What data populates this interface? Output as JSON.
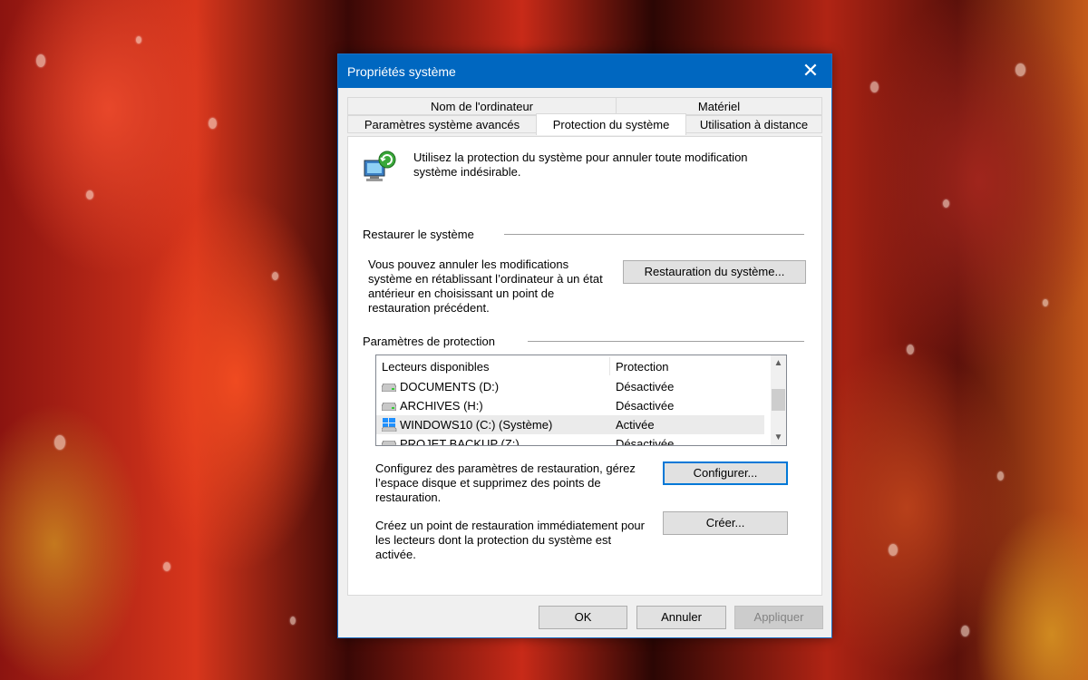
{
  "window": {
    "title": "Propriétés système",
    "close_glyph": "✕"
  },
  "tabs": {
    "row1": [
      "Nom de l'ordinateur",
      "Matériel"
    ],
    "row2": [
      "Paramètres système avancés",
      "Protection du système",
      "Utilisation à distance"
    ],
    "active": "Protection du système"
  },
  "intro": {
    "icon": "system-protection-icon",
    "text_line1": "Utilisez la protection du système pour annuler toute modification",
    "text_line2": "système indésirable."
  },
  "restore": {
    "group_label": "Restaurer le système",
    "desc_line1": "Vous pouvez annuler les modifications",
    "desc_line2": "système en rétablissant l’ordinateur à un état",
    "desc_line3": "antérieur en choisissant un point de",
    "desc_line4": "restauration précédent.",
    "button": "Restauration du système..."
  },
  "protection": {
    "group_label": "Paramètres de protection",
    "columns": [
      "Lecteurs disponibles",
      "Protection"
    ],
    "drives": [
      {
        "name": "DOCUMENTS (D:)",
        "protection": "Désactivée",
        "icon": "drive-icon"
      },
      {
        "name": "ARCHIVES (H:)",
        "protection": "Désactivée",
        "icon": "drive-icon"
      },
      {
        "name": "WINDOWS10 (C:) (Système)",
        "protection": "Activée",
        "icon": "windows-drive-icon"
      },
      {
        "name": "PROJET BACKUP (Z:)",
        "protection": "Désactivée",
        "icon": "drive-icon"
      }
    ],
    "configure_desc_line1": "Configurez des paramètres de restauration, gérez",
    "configure_desc_line2": "l’espace disque et supprimez des points de",
    "configure_desc_line3": "restauration.",
    "configure_button": "Configurer...",
    "create_desc_line1": "Créez un point de restauration immédiatement pour",
    "create_desc_line2": "les lecteurs dont la protection du système est",
    "create_desc_line3": "activée.",
    "create_button": "Créer..."
  },
  "footer": {
    "ok": "OK",
    "cancel": "Annuler",
    "apply": "Appliquer"
  }
}
